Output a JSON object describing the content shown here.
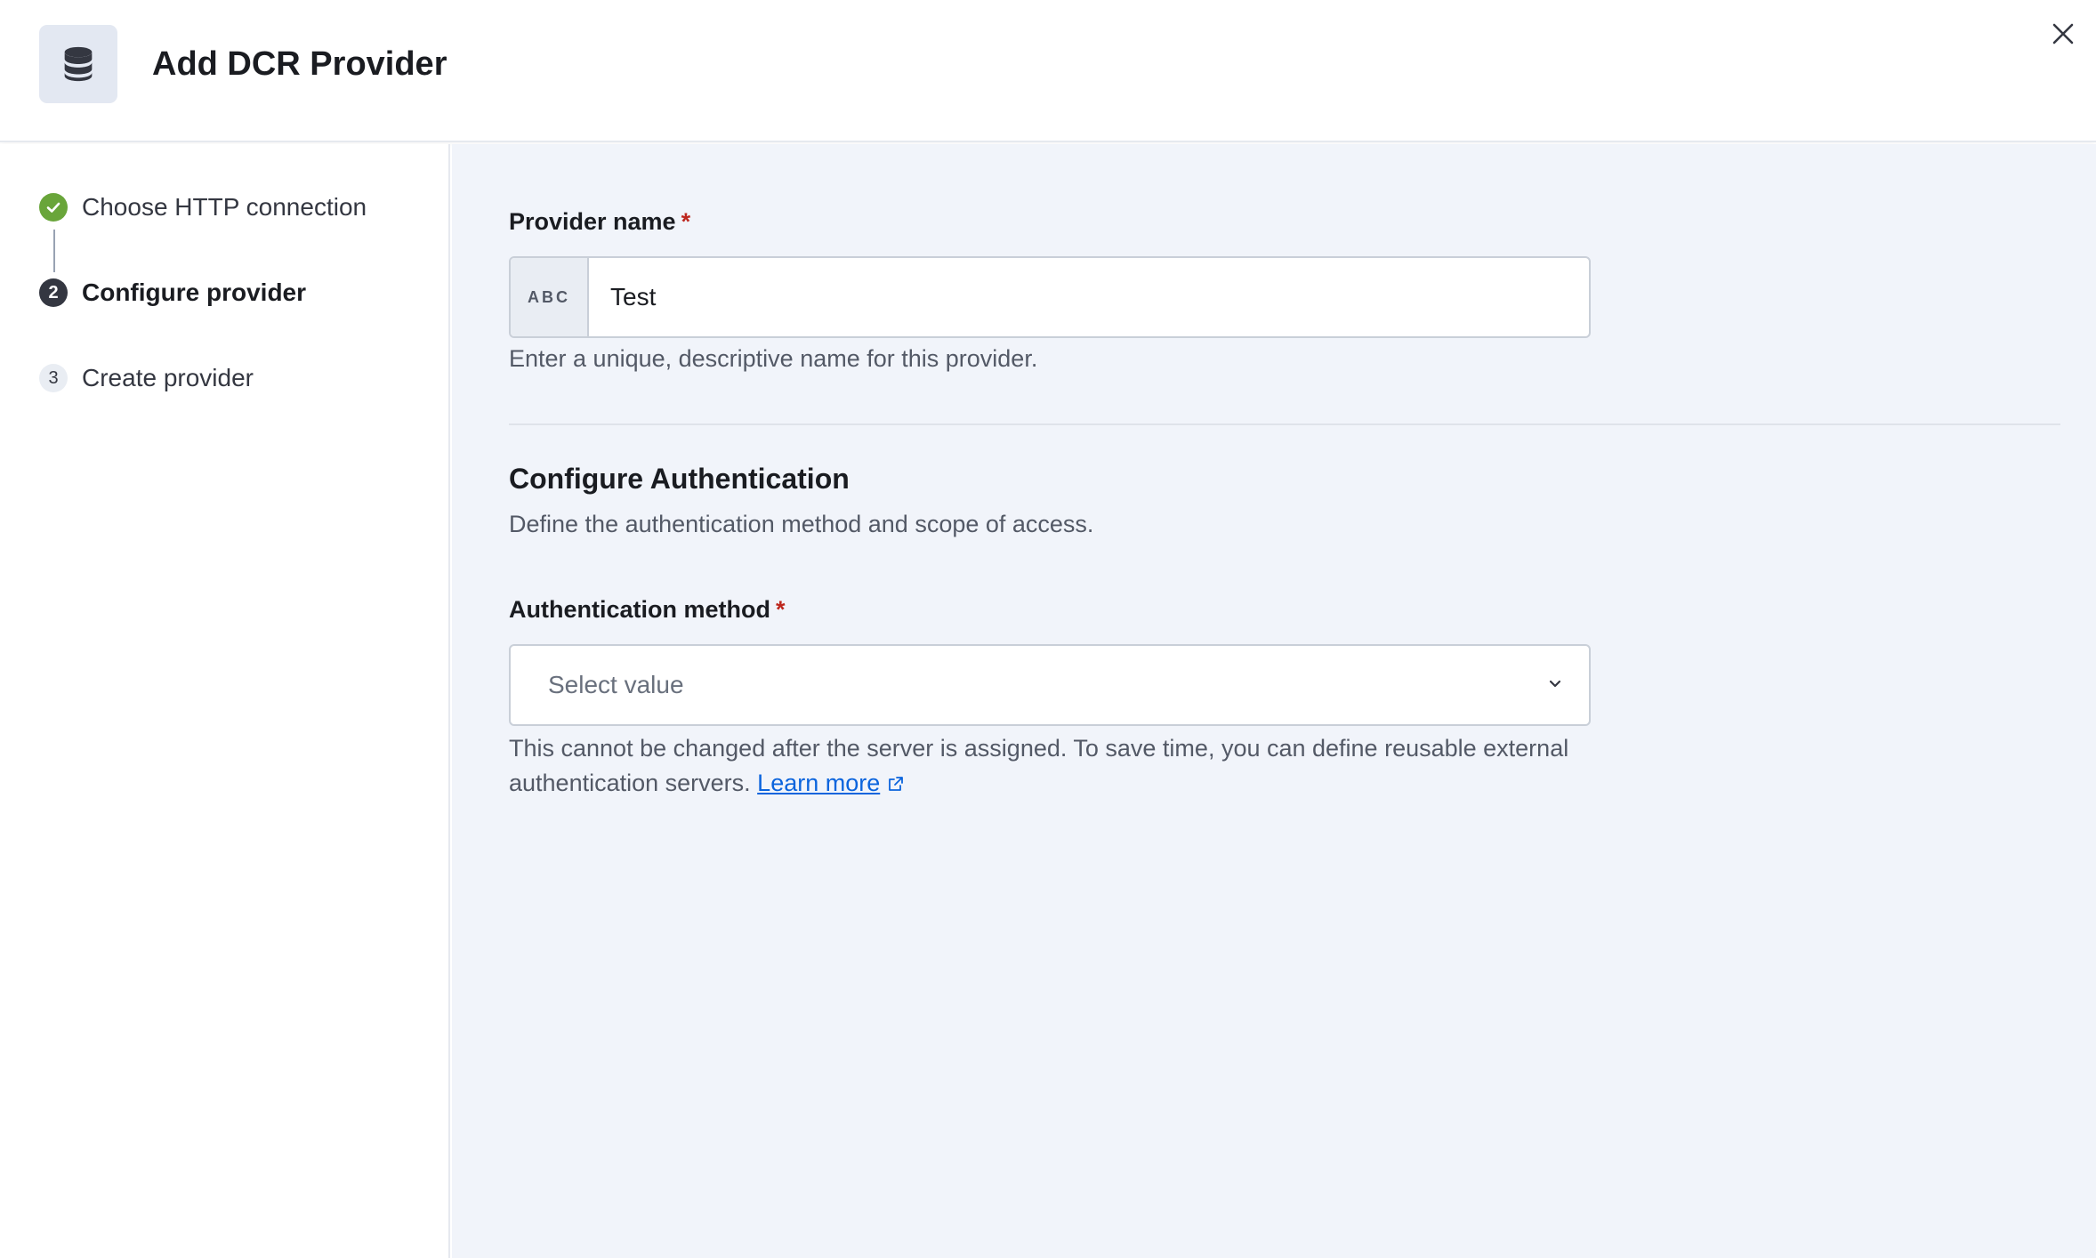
{
  "header": {
    "title": "Add DCR Provider",
    "icon": "database-icon",
    "close_icon": "close-icon"
  },
  "steps": [
    {
      "number": "1",
      "label": "Choose HTTP connection",
      "status": "complete"
    },
    {
      "number": "2",
      "label": "Configure provider",
      "status": "current"
    },
    {
      "number": "3",
      "label": "Create provider",
      "status": "upcoming"
    }
  ],
  "form": {
    "provider_name": {
      "label": "Provider name",
      "required_mark": "*",
      "prepend": "ABC",
      "value": "Test",
      "help": "Enter a unique, descriptive name for this provider."
    },
    "auth_section": {
      "title": "Configure Authentication",
      "description": "Define the authentication method and scope of access."
    },
    "auth_method": {
      "label": "Authentication method",
      "required_mark": "*",
      "placeholder": "Select value",
      "help_line1": "This cannot be changed after the server is assigned. To save time, you can define reusable external",
      "help_line2": "authentication servers.",
      "link_text": "Learn more"
    }
  },
  "colors": {
    "success": "#69a53a",
    "current_step": "#343741",
    "required": "#bd271e",
    "link": "#0b64dd",
    "panel_bg": "#f1f4fa"
  }
}
